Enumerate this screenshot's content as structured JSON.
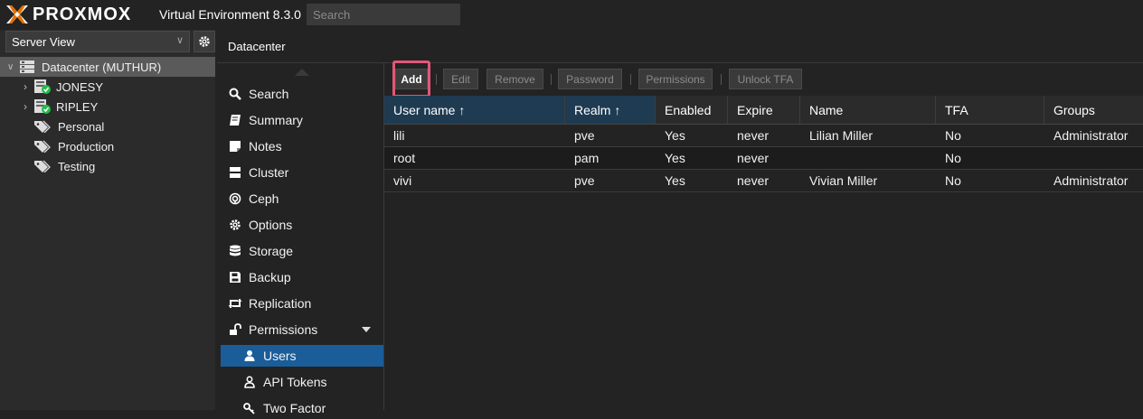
{
  "app": {
    "logo_text": "PROXMOX",
    "product": "Virtual Environment 8.3.0",
    "search_placeholder": "Search"
  },
  "tree": {
    "view_label": "Server View",
    "nodes": [
      {
        "label": "Datacenter (MUTHUR)",
        "icon": "datacenter-icon",
        "selected": true
      },
      {
        "label": "JONESY",
        "icon": "node-online-icon"
      },
      {
        "label": "RIPLEY",
        "icon": "node-online-icon"
      },
      {
        "label": "Personal",
        "icon": "tag-icon"
      },
      {
        "label": "Production",
        "icon": "tag-icon"
      },
      {
        "label": "Testing",
        "icon": "tag-icon"
      }
    ]
  },
  "content": {
    "title": "Datacenter"
  },
  "nav": {
    "items": [
      {
        "label": "Search",
        "icon": "search-icon"
      },
      {
        "label": "Summary",
        "icon": "book-icon"
      },
      {
        "label": "Notes",
        "icon": "notes-icon"
      },
      {
        "label": "Cluster",
        "icon": "server-icon"
      },
      {
        "label": "Ceph",
        "icon": "ceph-icon"
      },
      {
        "label": "Options",
        "icon": "gear-icon"
      },
      {
        "label": "Storage",
        "icon": "database-icon"
      },
      {
        "label": "Backup",
        "icon": "floppy-icon"
      },
      {
        "label": "Replication",
        "icon": "retweet-icon"
      },
      {
        "label": "Permissions",
        "icon": "unlock-icon",
        "expanded": true
      },
      {
        "label": "Users",
        "icon": "user-icon",
        "active": true,
        "sub": true
      },
      {
        "label": "API Tokens",
        "icon": "user-o-icon",
        "sub": true
      },
      {
        "label": "Two Factor",
        "icon": "key-icon",
        "sub": true
      }
    ]
  },
  "toolbar": {
    "add": "Add",
    "edit": "Edit",
    "remove": "Remove",
    "password": "Password",
    "permissions": "Permissions",
    "unlock_tfa": "Unlock TFA"
  },
  "grid": {
    "columns": [
      "User name ↑",
      "Realm ↑",
      "Enabled",
      "Expire",
      "Name",
      "TFA",
      "Groups"
    ],
    "rows": [
      [
        "lili",
        "pve",
        "Yes",
        "never",
        "Lilian Miller",
        "No",
        "Administrator"
      ],
      [
        "root",
        "pam",
        "Yes",
        "never",
        "",
        "No",
        ""
      ],
      [
        "vivi",
        "pve",
        "Yes",
        "never",
        "Vivian Miller",
        "No",
        "Administrator"
      ]
    ]
  },
  "colors": {
    "accent": "#1a5d99",
    "logo_orange": "#e57000",
    "highlight": "#e0577a",
    "online": "#21bf4b"
  }
}
